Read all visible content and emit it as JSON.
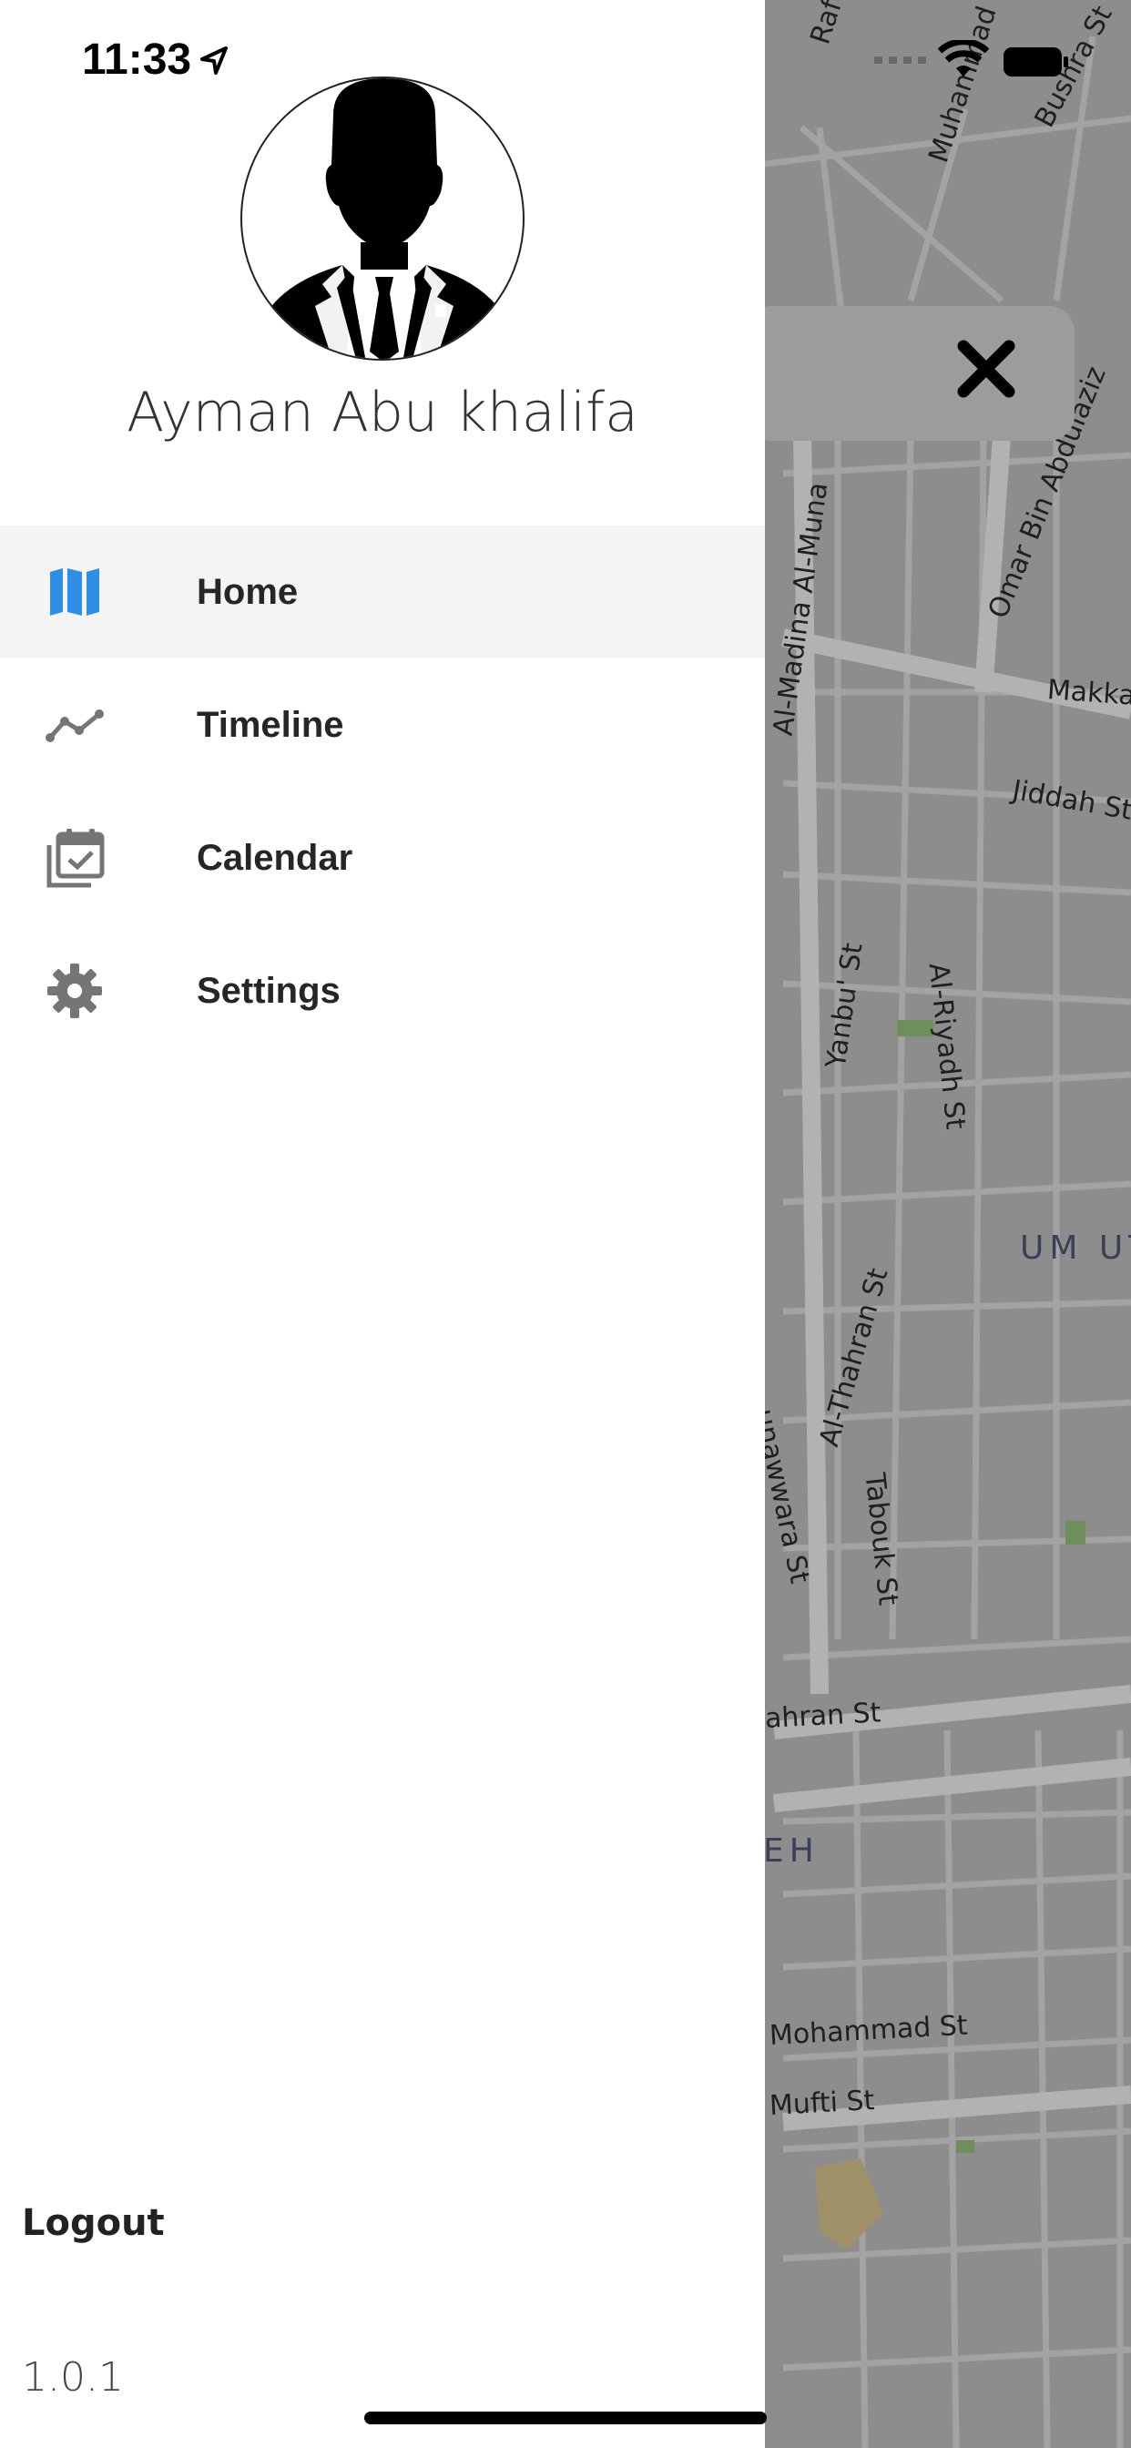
{
  "status_bar": {
    "time": "11:33"
  },
  "profile": {
    "name": "Ayman Abu khalifa"
  },
  "menu": {
    "items": [
      {
        "label": "Home",
        "icon": "map-icon",
        "active": true
      },
      {
        "label": "Timeline",
        "icon": "timeline-icon",
        "active": false
      },
      {
        "label": "Calendar",
        "icon": "calendar-check-icon",
        "active": false
      },
      {
        "label": "Settings",
        "icon": "gear-icon",
        "active": false
      }
    ]
  },
  "footer": {
    "logout_label": "Logout",
    "version": "1.0.1"
  },
  "map": {
    "streets": [
      "Rafe'",
      "Muhammad",
      "Bushra St",
      "Omar Bin Abdulaziz",
      "Al-Madina Al-Muna",
      "Makka",
      "Jiddah St",
      "Yanbu' St",
      "Al-Riyadh St",
      "Al-Thahran St",
      "Tabouk St",
      "unawwara St",
      "ahran St",
      "Mohammad St",
      "Mufti St"
    ],
    "districts": [
      "UM UT",
      "EH"
    ]
  },
  "colors": {
    "accent": "#2f8fe6",
    "icon_gray": "#757575",
    "map_background": "#8d8d8d"
  }
}
